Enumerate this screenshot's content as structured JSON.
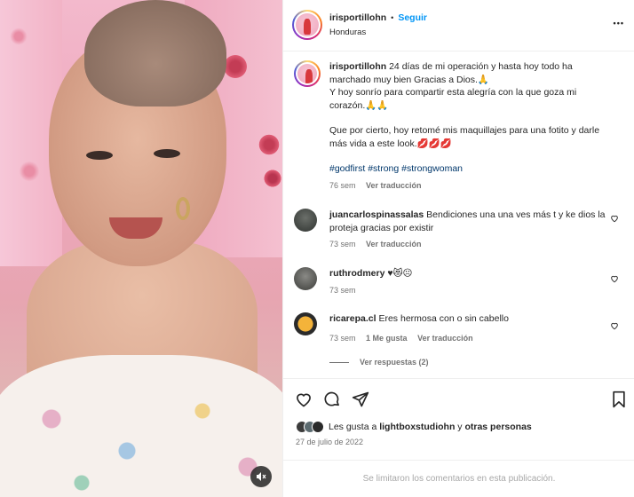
{
  "post": {
    "username": "irisportillohn",
    "separator": "•",
    "follow_label": "Seguir",
    "location": "Honduras",
    "more_label": "•••"
  },
  "caption": {
    "username": "irisportillohn",
    "text_line1": "24 días de mi operación y hasta hoy todo ha marchado muy bien Gracias a Dios.🙏",
    "text_line2": "Y hoy sonrío para compartir esta alegría con la que goza mi corazón.🙏🙏",
    "text_line3": "Que por cierto, hoy retomé mis maquillajes para una fotito y darle más vida a este look.💋💋💋",
    "hashtags": "#godfirst #strong #strongwoman",
    "time": "76 sem",
    "translate": "Ver traducción"
  },
  "comments": [
    {
      "username": "juancarlospinassalas",
      "text": "Bendiciones una una ves más t y ke dios la proteja gracias por existir",
      "time": "73 sem",
      "translate": "Ver traducción"
    },
    {
      "username": "ruthrodmery",
      "text": "♥😻☹",
      "time": "73 sem"
    },
    {
      "username": "ricarepa.cl",
      "text": "Eres hermosa con o sin cabello",
      "time": "73 sem",
      "likes": "1 Me gusta",
      "translate": "Ver traducción",
      "replies": "Ver respuestas (2)"
    }
  ],
  "likes": {
    "prefix": "Les gusta a",
    "user": "lightboxstudiohn",
    "middle": "y",
    "others": "otras personas"
  },
  "date": "27 de julio de 2022",
  "footer": "Se limitaron los comentarios en esta publicación.",
  "colors": {
    "link_blue": "#0095f6",
    "text": "#262626",
    "muted": "#737373",
    "hashtag": "#00376b"
  }
}
